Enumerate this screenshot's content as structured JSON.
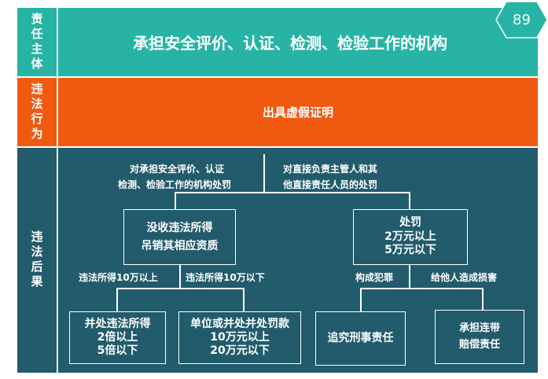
{
  "page_number": "89",
  "rows": {
    "subject": {
      "label": "责任主体",
      "text": "承担安全评价、认证、检测、检验工作的机构"
    },
    "behavior": {
      "label": "违法行为",
      "text": "出具虚假证明"
    },
    "consequence": {
      "label": "违法后果"
    }
  },
  "colors": {
    "teal": "#27b4a4",
    "orange": "#f05a10",
    "dark_teal": "#225b6c",
    "hexagon": "#27b4a4"
  },
  "tree": {
    "branch_org_l1": "对承担安全评价、认证",
    "branch_org_l2": "检测、检验工作的机构处罚",
    "branch_person_l1": "对直接负责主管人和其",
    "branch_person_l2": "他直接责任人员的处罚",
    "box_confiscate_l1": "没收违法所得",
    "box_confiscate_l2": "吊销其相应资质",
    "box_fine_l1": "处罚",
    "box_fine_l2": "2万元以上",
    "box_fine_l3": "5万元以下",
    "branch_over_10w": "违法所得10万以上",
    "branch_under_10w": "违法所得10万以下",
    "branch_crime": "构成犯罪",
    "branch_damage": "给他人造成损害",
    "box_multiple_l1": "并处违法所得",
    "box_multiple_l2": "2倍以上",
    "box_multiple_l3": "5倍以下",
    "box_unit_l1": "单位或并处并处罚款",
    "box_unit_l2": "10万元以上",
    "box_unit_l3": "20万元以下",
    "box_criminal": "追究刑事责任",
    "box_joint_l1": "承担连带",
    "box_joint_l2": "赔偿责任"
  }
}
